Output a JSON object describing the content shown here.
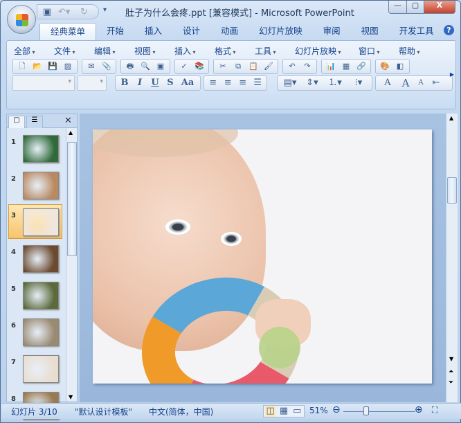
{
  "window": {
    "title": "肚子为什么会疼.ppt [兼容模式] - Microsoft PowerPoint",
    "minimize": "—",
    "maximize": "▢",
    "close": "X"
  },
  "qat": {
    "icons": [
      "save-icon",
      "undo-icon",
      "redo-icon",
      "customize-icon"
    ]
  },
  "tabs": [
    "经典菜单",
    "开始",
    "插入",
    "设计",
    "动画",
    "幻灯片放映",
    "审阅",
    "视图",
    "开发工具"
  ],
  "help": "?",
  "menu": [
    "全部",
    "文件",
    "编辑",
    "视图",
    "插入",
    "格式",
    "工具",
    "幻灯片放映",
    "窗口",
    "帮助"
  ],
  "toolbar1": [
    [
      "new-icon",
      "open-icon",
      "save-icon",
      "permission-icon"
    ],
    [
      "email-icon",
      "attach-icon"
    ],
    [
      "print-icon",
      "preview-icon",
      "frame-icon"
    ],
    [
      "spelling-icon",
      "research-icon"
    ],
    [
      "cut-icon",
      "copy-icon",
      "paste-icon",
      "format-painter-icon"
    ],
    [
      "undo-icon",
      "redo-icon"
    ],
    [
      "chart-icon",
      "table-icon",
      "hyperlink-icon"
    ],
    [
      "color-icon",
      "grayscale-icon"
    ]
  ],
  "toolbar2": {
    "bold": "B",
    "italic": "I",
    "underline": "U",
    "shadow": "S",
    "case": "Aa",
    "grow": "A",
    "big": "A",
    "small": "A"
  },
  "panel": {
    "slides": [
      {
        "n": "1",
        "bg": "#2f6b3a"
      },
      {
        "n": "2",
        "bg": "#b98a62"
      },
      {
        "n": "3",
        "bg": "#efe6df"
      },
      {
        "n": "4",
        "bg": "#6c4a30"
      },
      {
        "n": "5",
        "bg": "#5a6a3a"
      },
      {
        "n": "6",
        "bg": "#9a8a72"
      },
      {
        "n": "7",
        "bg": "#e9ddd0"
      },
      {
        "n": "8",
        "bg": "#9a7a50"
      }
    ],
    "selected": 3
  },
  "status": {
    "slide": "幻灯片 3/10",
    "theme": "\"默认设计模板\"",
    "language": "中文(简体，中国)",
    "zoom": "51%",
    "zoom_value": 51
  }
}
